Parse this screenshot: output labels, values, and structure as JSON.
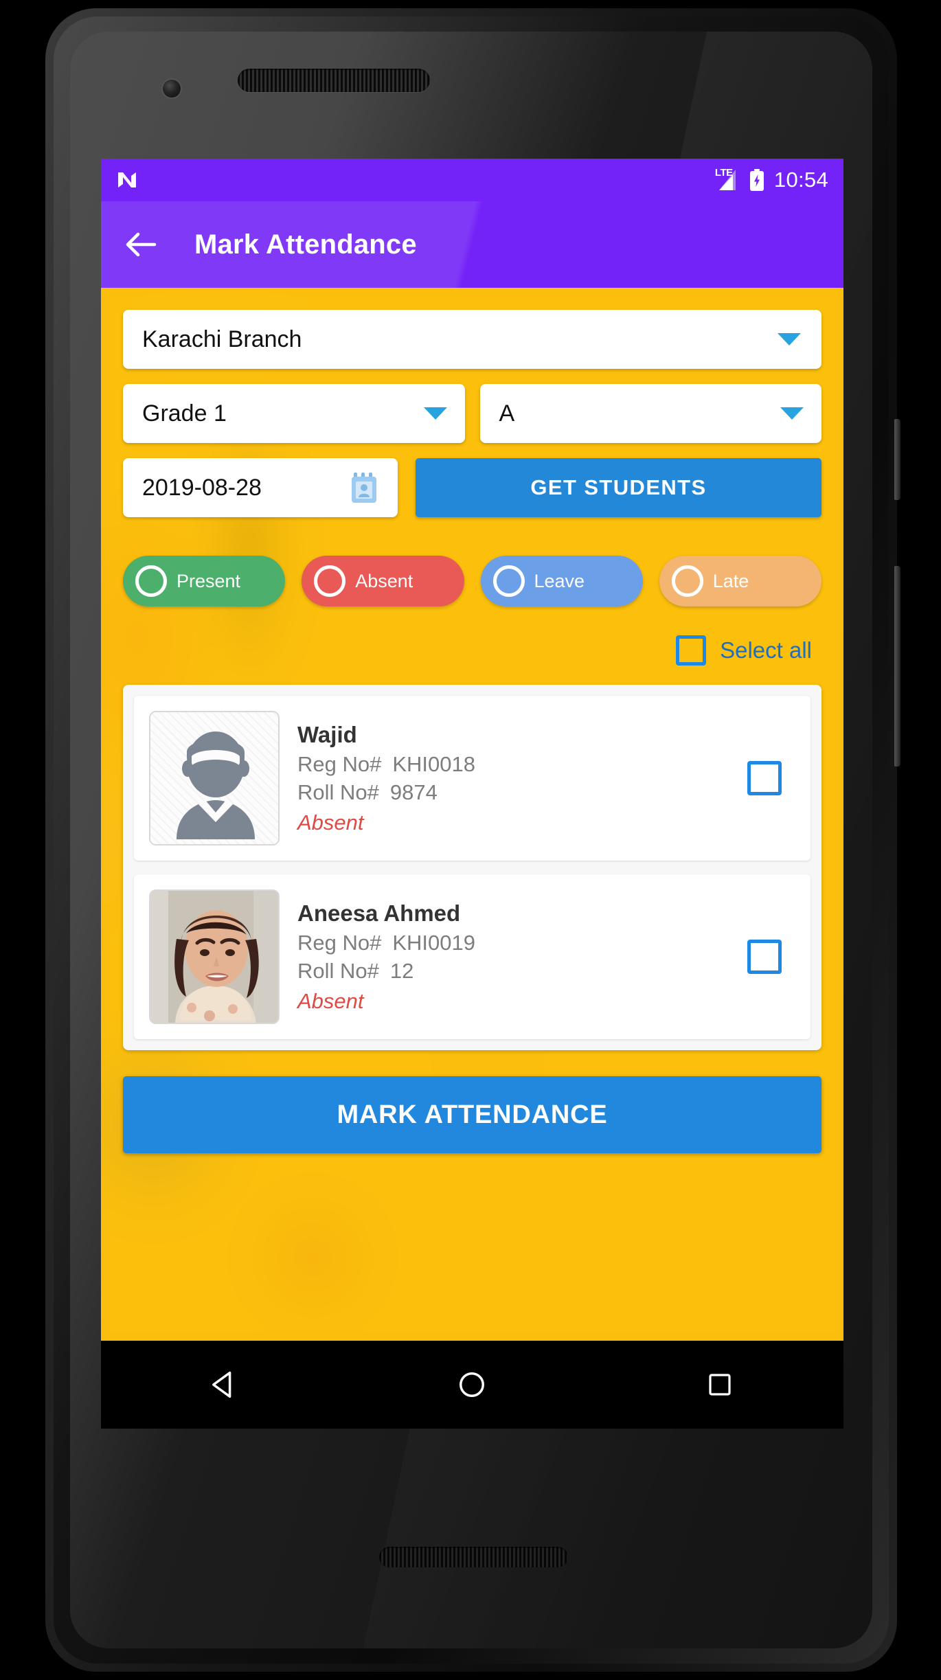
{
  "status_bar": {
    "os_logo": "android-n-logo",
    "network": "LTE",
    "battery": "battery-charging-icon",
    "clock": "10:54"
  },
  "app_bar": {
    "back": "back-arrow-icon",
    "title": "Mark Attendance"
  },
  "form": {
    "branch": {
      "label": "Karachi Branch",
      "caret": "chevron-down-icon"
    },
    "grade": {
      "label": "Grade 1",
      "caret": "chevron-down-icon"
    },
    "class": {
      "label": "A",
      "caret": "chevron-down-icon"
    },
    "date": {
      "value": "2019-08-28",
      "icon": "calendar-icon"
    },
    "get_students_label": "GET STUDENTS"
  },
  "status_chips": [
    {
      "label": "Present",
      "color": "#4caf6b",
      "selected": false
    },
    {
      "label": "Absent",
      "color": "#e95a56",
      "selected": false
    },
    {
      "label": "Leave",
      "color": "#6b9fe8",
      "selected": false
    },
    {
      "label": "Late",
      "color": "#f3b571",
      "selected": false
    }
  ],
  "select_all": {
    "label": "Select all",
    "checked": false
  },
  "students": [
    {
      "name": "Wajid",
      "reg_label": "Reg No#",
      "reg_value": "KHI0018",
      "roll_label": "Roll No#",
      "roll_value": "9874",
      "status": "Absent",
      "avatar": "placeholder-avatar-icon",
      "checked": false
    },
    {
      "name": "Aneesa Ahmed",
      "reg_label": "Reg No#",
      "reg_value": "KHI0019",
      "roll_label": "Roll No#",
      "roll_value": "12",
      "status": "Absent",
      "avatar": "student-photo",
      "checked": false
    }
  ],
  "mark_attendance_label": "MARK ATTENDANCE",
  "nav_bar": {
    "back": "nav-back-icon",
    "home": "nav-home-icon",
    "recents": "nav-recents-icon"
  },
  "colors": {
    "app_bar": "#7323f7",
    "background": "#fcc10b",
    "primary_button": "#2288dd",
    "accent_blue": "#1e88e5",
    "absent_red": "#e04a44"
  }
}
